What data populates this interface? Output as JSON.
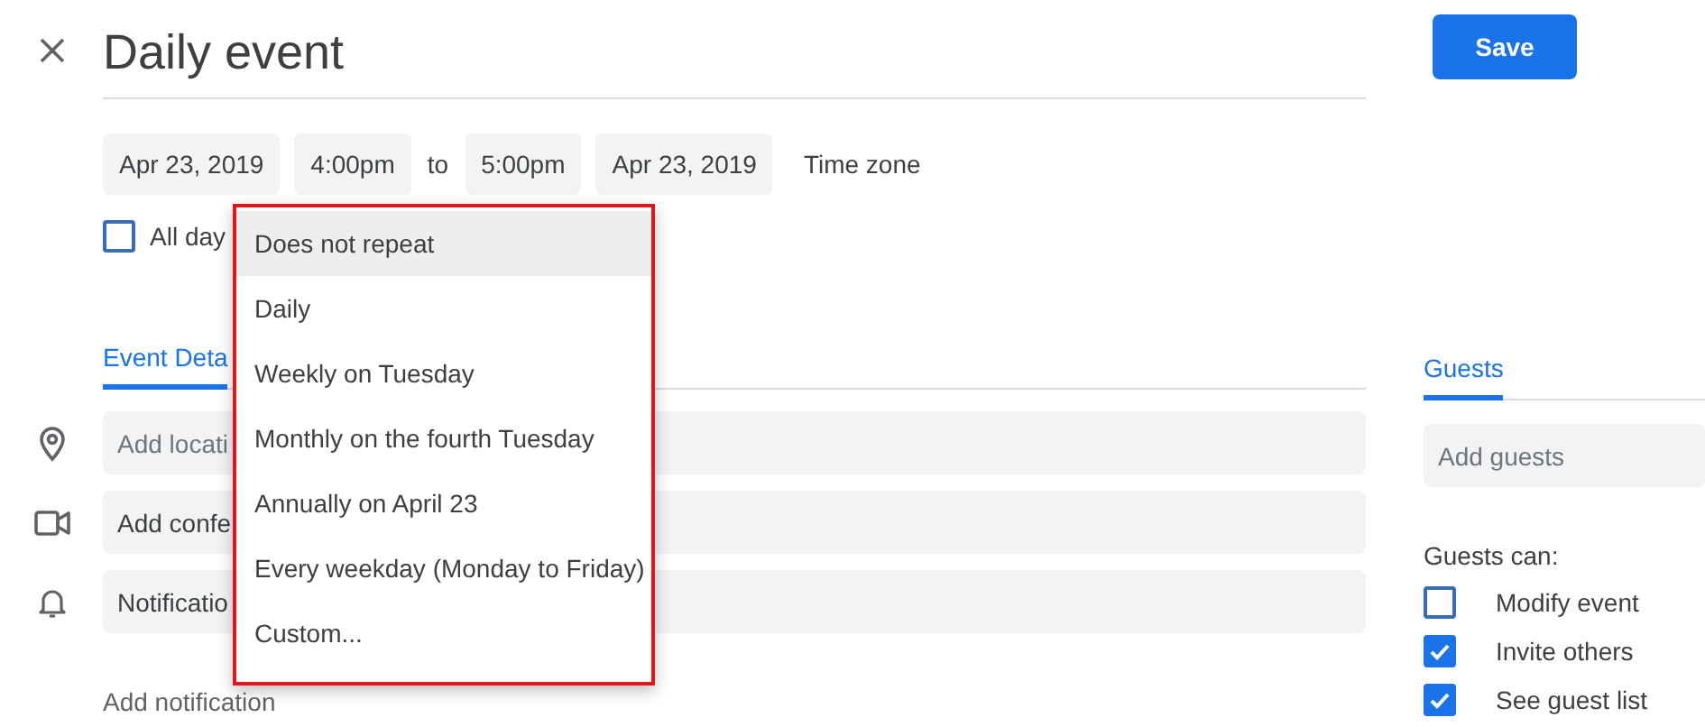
{
  "header": {
    "title": "Daily event",
    "save": "Save"
  },
  "date_row": {
    "start_date": "Apr 23, 2019",
    "start_time": "4:00pm",
    "separator": "to",
    "end_time": "5:00pm",
    "end_date": "Apr 23, 2019",
    "time_zone": "Time zone"
  },
  "all_day": {
    "label": "All day",
    "checked": false
  },
  "tabs": [
    {
      "label": "Event Deta",
      "selected": true
    }
  ],
  "fields": [
    {
      "kind": "location",
      "placeholder": "Add locati"
    },
    {
      "kind": "conference",
      "value": "Add confe"
    },
    {
      "kind": "notification",
      "value": "Notificatio"
    }
  ],
  "add_notification": "Add notification",
  "guests": {
    "tab": {
      "label": "Guests",
      "selected": true
    },
    "placeholder": "Add guests",
    "permissions_title": "Guests can:",
    "permissions": [
      {
        "label": "Modify event",
        "checked": false
      },
      {
        "label": "Invite others",
        "checked": true
      },
      {
        "label": "See guest list",
        "checked": true
      }
    ]
  },
  "repeat_menu": {
    "options": [
      {
        "label": "Does not repeat",
        "selected": true
      },
      {
        "label": "Daily",
        "selected": false
      },
      {
        "label": "Weekly on Tuesday",
        "selected": false
      },
      {
        "label": "Monthly on the fourth Tuesday",
        "selected": false
      },
      {
        "label": "Annually on April 23",
        "selected": false
      },
      {
        "label": "Every weekday (Monday to Friday)",
        "selected": false
      },
      {
        "label": "Custom...",
        "selected": false
      }
    ]
  }
}
